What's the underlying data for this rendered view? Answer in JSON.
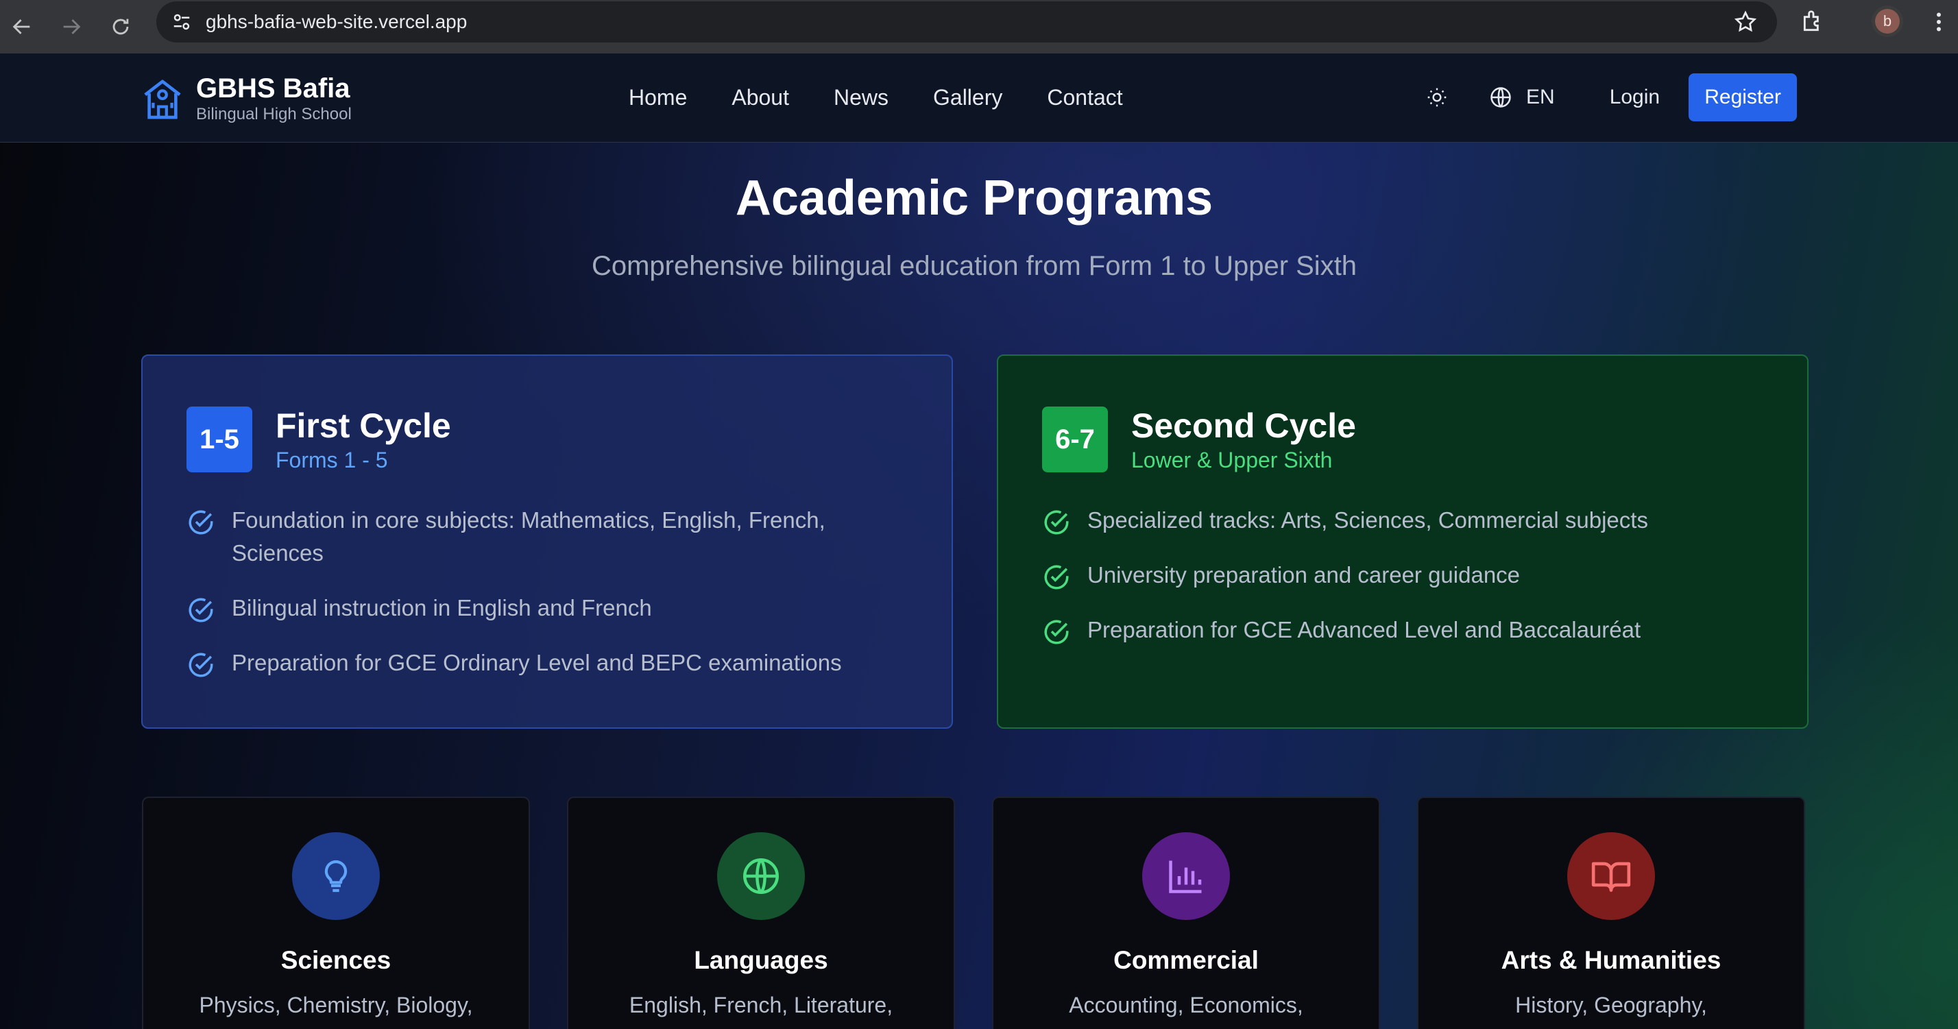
{
  "browser": {
    "url": "gbhs-bafia-web-site.vercel.app",
    "profile_initial": "b"
  },
  "header": {
    "brand_name": "GBHS Bafia",
    "brand_sub": "Bilingual High School",
    "nav": [
      "Home",
      "About",
      "News",
      "Gallery",
      "Contact"
    ],
    "lang": "EN",
    "login": "Login",
    "register": "Register"
  },
  "hero": {
    "title": "Academic Programs",
    "subtitle": "Comprehensive bilingual education from Form 1 to Upper Sixth"
  },
  "cycles": [
    {
      "badge": "1-5",
      "name": "First Cycle",
      "forms": "Forms 1 - 5",
      "accent": "#2563eb",
      "items": [
        "Foundation in core subjects: Mathematics, English, French, Sciences",
        "Bilingual instruction in English and French",
        "Preparation for GCE Ordinary Level and BEPC examinations"
      ]
    },
    {
      "badge": "6-7",
      "name": "Second Cycle",
      "forms": "Lower & Upper Sixth",
      "accent": "#16a34a",
      "items": [
        "Specialized tracks: Arts, Sciences, Commercial subjects",
        "University preparation and career guidance",
        "Preparation for GCE Advanced Level and Baccalauréat"
      ]
    }
  ],
  "subjects": [
    {
      "name": "Sciences",
      "desc": "Physics, Chemistry, Biology,",
      "icon": "lightbulb-icon",
      "color": "#1e3a8a",
      "icon_color": "#60a5fa"
    },
    {
      "name": "Languages",
      "desc": "English, French, Literature,",
      "icon": "globe-icon",
      "color": "#14532d",
      "icon_color": "#4ade80"
    },
    {
      "name": "Commercial",
      "desc": "Accounting, Economics,",
      "icon": "bar-chart-icon",
      "color": "#581c87",
      "icon_color": "#c084fc"
    },
    {
      "name": "Arts & Humanities",
      "desc": "History, Geography,",
      "icon": "book-open-icon",
      "color": "#7f1d1d",
      "icon_color": "#f87171"
    }
  ]
}
